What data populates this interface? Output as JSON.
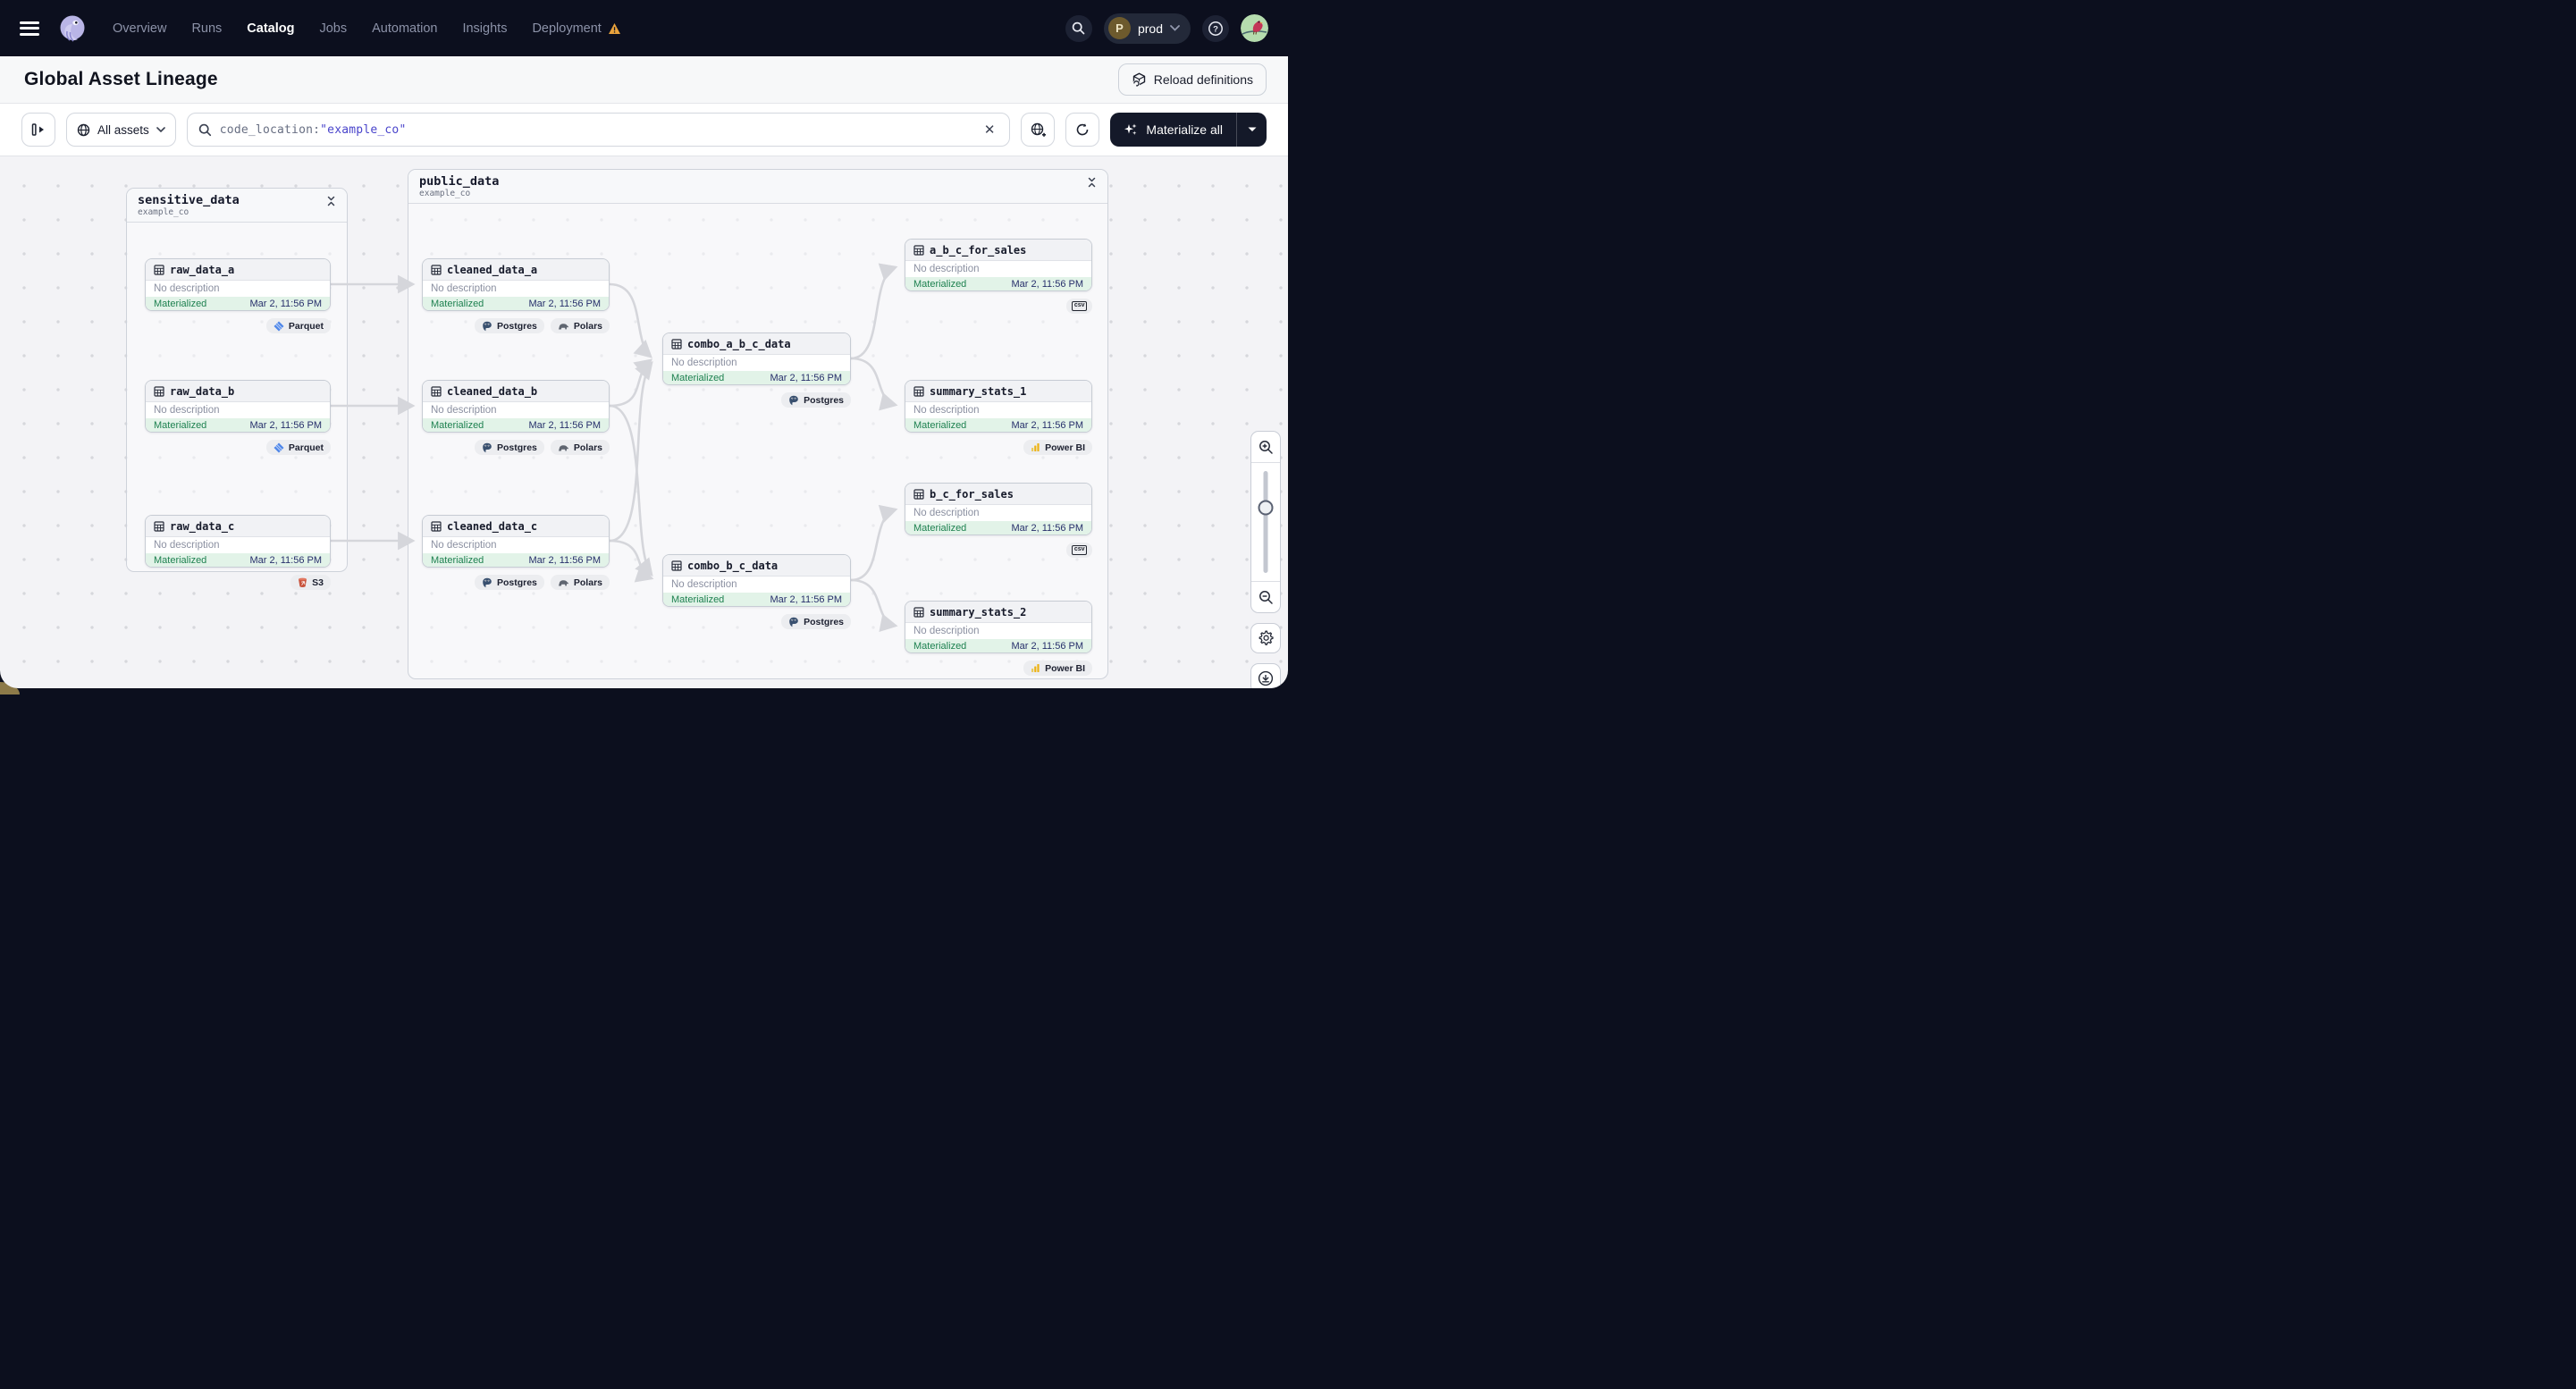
{
  "nav": {
    "brand": "Dagster",
    "items": [
      {
        "label": "Overview",
        "active": false
      },
      {
        "label": "Runs",
        "active": false
      },
      {
        "label": "Catalog",
        "active": true
      },
      {
        "label": "Jobs",
        "active": false
      },
      {
        "label": "Automation",
        "active": false
      },
      {
        "label": "Insights",
        "active": false
      },
      {
        "label": "Deployment",
        "active": false,
        "warning": true
      }
    ],
    "env": {
      "initial": "P",
      "name": "prod"
    }
  },
  "page": {
    "title": "Global Asset Lineage",
    "reload_button": "Reload definitions"
  },
  "toolbar": {
    "scope_button": "All assets",
    "search_prefix": "code_location:",
    "search_value": "\"example_co\"",
    "materialize_button": "Materialize all"
  },
  "graph": {
    "groups": [
      {
        "name": "sensitive_data",
        "location": "example_co"
      },
      {
        "name": "public_data",
        "location": "example_co"
      }
    ],
    "node_defaults": {
      "description": "No description",
      "status": "Materialized",
      "timestamp": "Mar 2, 11:56 PM"
    },
    "nodes": [
      {
        "name": "raw_data_a",
        "tags": [
          "Parquet"
        ]
      },
      {
        "name": "raw_data_b",
        "tags": [
          "Parquet"
        ]
      },
      {
        "name": "raw_data_c",
        "tags": [
          "S3"
        ]
      },
      {
        "name": "cleaned_data_a",
        "tags": [
          "Postgres",
          "Polars"
        ]
      },
      {
        "name": "cleaned_data_b",
        "tags": [
          "Postgres",
          "Polars"
        ]
      },
      {
        "name": "cleaned_data_c",
        "tags": [
          "Postgres",
          "Polars"
        ]
      },
      {
        "name": "combo_a_b_c_data",
        "tags": [
          "Postgres"
        ]
      },
      {
        "name": "combo_b_c_data",
        "tags": [
          "Postgres"
        ]
      },
      {
        "name": "a_b_c_for_sales",
        "tags": [
          "csv"
        ]
      },
      {
        "name": "summary_stats_1",
        "tags": [
          "Power BI"
        ]
      },
      {
        "name": "b_c_for_sales",
        "tags": [
          "csv"
        ]
      },
      {
        "name": "summary_stats_2",
        "tags": [
          "Power BI"
        ]
      }
    ],
    "tag_labels": {
      "parquet": "Parquet",
      "s3": "S3",
      "postgres": "Postgres",
      "polars": "Polars",
      "powerbi": "Power BI",
      "csv": "csv"
    }
  },
  "colors": {
    "nav_bg": "#0c0f1e",
    "accent_dark": "#141929",
    "status_green": "#1e8150",
    "status_bg": "#e2f3e8",
    "timestamp_navy": "#272f6b",
    "search_value_blue": "#4a45cb",
    "warning_orange": "#e9a23b",
    "powerbi_yellow": "#edb211",
    "s3_red": "#c8533c",
    "parquet_blue": "#4f86e8"
  }
}
